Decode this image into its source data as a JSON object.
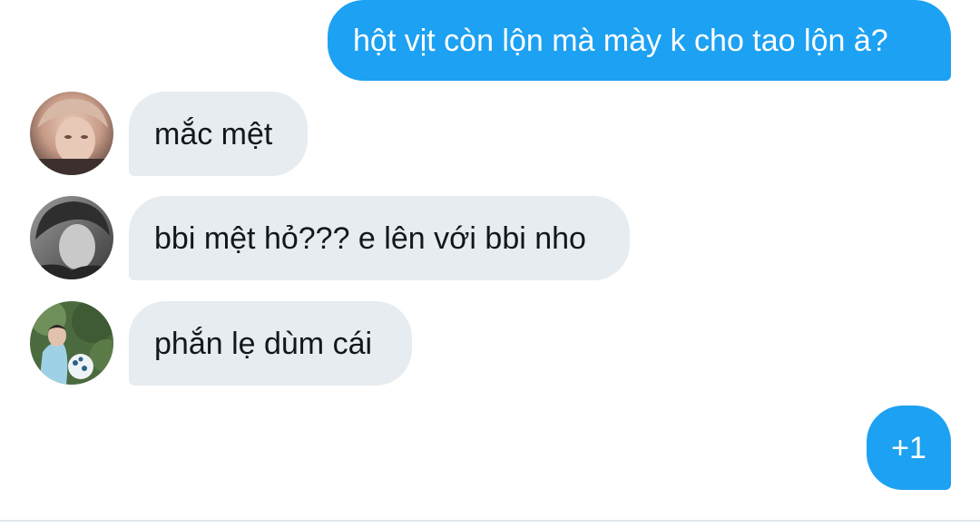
{
  "conversation": {
    "messages": [
      {
        "sender": "me",
        "text": "hột vịt còn lộn mà mày k cho tao lộn à?"
      },
      {
        "sender": "user1",
        "text": "mắc mệt"
      },
      {
        "sender": "user2",
        "text": "bbi mệt hỏ??? e lên với bbi nho"
      },
      {
        "sender": "user3",
        "text": "phắn lẹ dùm cái"
      },
      {
        "sender": "me",
        "text": "+1"
      }
    ]
  },
  "colors": {
    "sent_bubble": "#1da1f2",
    "received_bubble": "#e6ecf0",
    "received_text": "#14171a"
  }
}
